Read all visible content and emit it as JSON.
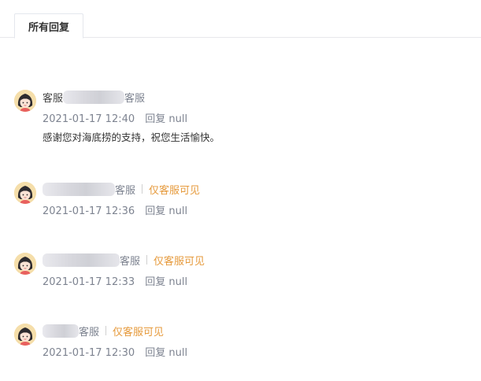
{
  "tabs": [
    {
      "label": "所有回复"
    }
  ],
  "replies": [
    {
      "role_prefix": "客服",
      "role": "客服",
      "time": "2021-01-17 12:40",
      "reply_label": "回复 null",
      "content": "感谢您对海底捞的支持，祝您生活愉快。"
    },
    {
      "role": "客服",
      "private_label": "仅客服可见",
      "time": "2021-01-17 12:36",
      "reply_label": "回复 null"
    },
    {
      "role": "客服",
      "private_label": "仅客服可见",
      "time": "2021-01-17 12:33",
      "reply_label": "回复 null"
    },
    {
      "role": "客服",
      "private_label": "仅客服可见",
      "time": "2021-01-17 12:30",
      "reply_label": "回复 null"
    }
  ],
  "colors": {
    "private": "#e69a3c",
    "meta": "#7d8390",
    "avatar_bg": "#f5deaa"
  },
  "icons": {
    "avatar": "female-user-avatar-icon"
  }
}
